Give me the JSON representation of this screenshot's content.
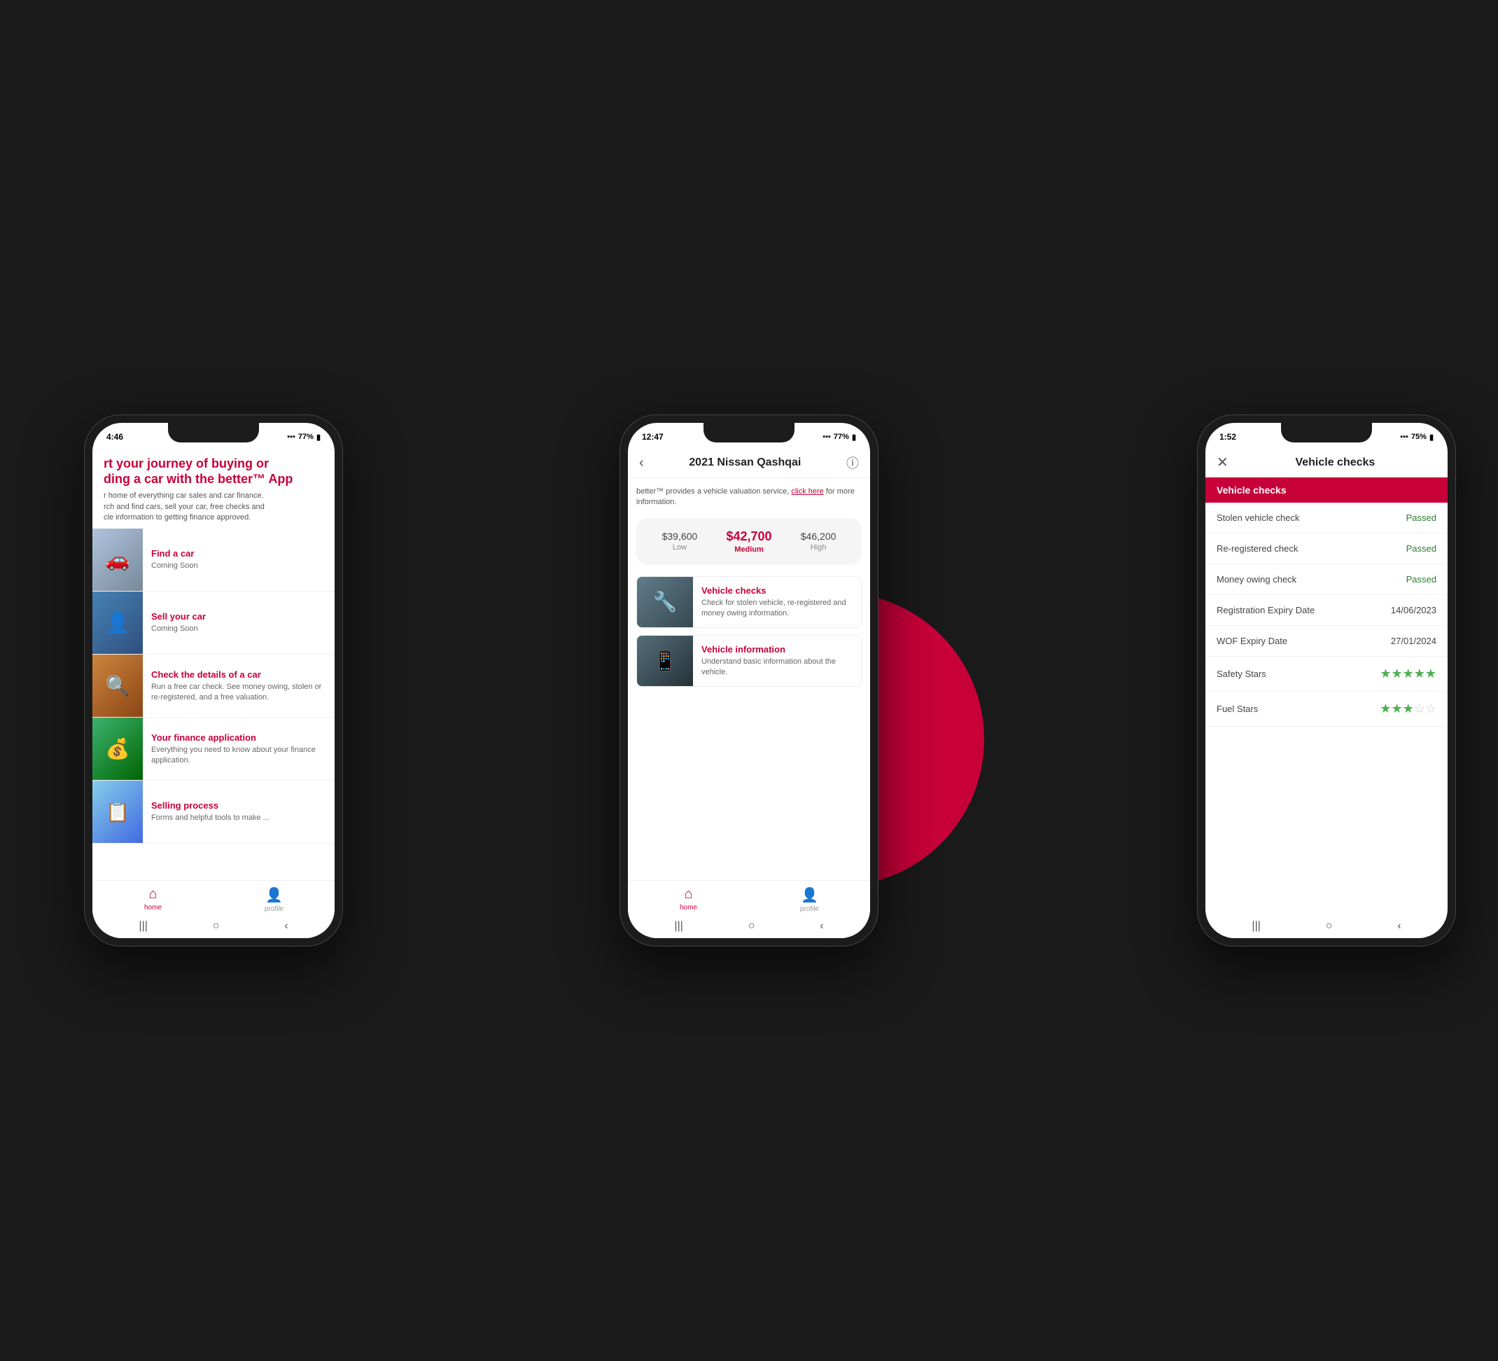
{
  "background": "#1a1a1a",
  "phone1": {
    "status": {
      "time": "4:46",
      "signal": "▪▪▪",
      "wifi": "wifi",
      "battery": "77%"
    },
    "header": {
      "title": "rt your journey of buying or\nding a car with the better™ App",
      "subtitle": "r home of everything car sales and car finance.\nrch and find cars, sell your car, free checks and\ncle information to getting finance approved."
    },
    "items": [
      {
        "title": "Find a car",
        "desc": "Coming Soon",
        "img": "🚗"
      },
      {
        "title": "Sell your car",
        "desc": "Coming Soon",
        "img": "👤"
      },
      {
        "title": "Check the details of a car",
        "desc": "Run a free car check. See money owing, stolen or re-registered, and a free valuation.",
        "img": "🔍"
      },
      {
        "title": "Your finance application",
        "desc": "Everything you need to know about your finance application.",
        "img": "💰"
      },
      {
        "title": "Selling process",
        "desc": "Forms and helpful tools to make ...",
        "img": "📋"
      }
    ],
    "nav": {
      "home": "home",
      "profile": "profile"
    },
    "homeBar": [
      "|||",
      "○",
      "‹"
    ]
  },
  "phone2": {
    "status": {
      "time": "12:47",
      "battery": "77%"
    },
    "header": {
      "back": "‹",
      "title": "2021 Nissan Qashqai",
      "info": "ⓘ"
    },
    "valuationNote": "better™ provides a vehicle valuation service, click here for more information.",
    "valuationLink": "click here",
    "valuation": {
      "low": {
        "amount": "$39,600",
        "label": "Low"
      },
      "medium": {
        "amount": "$42,700",
        "label": "Medium"
      },
      "high": {
        "amount": "$46,200",
        "label": "High"
      }
    },
    "features": [
      {
        "title": "Vehicle checks",
        "desc": "Check for stolen vehicle, re-registered and money owing information.",
        "img": "🔧"
      },
      {
        "title": "Vehicle information",
        "desc": "Understand basic information about the vehicle.",
        "img": "📱"
      }
    ],
    "nav": {
      "home": "home",
      "profile": "profile"
    },
    "homeBar": [
      "|||",
      "○",
      "‹"
    ]
  },
  "phone3": {
    "status": {
      "time": "1:52",
      "battery": "75%"
    },
    "header": {
      "close": "✕",
      "title": "Vehicle checks"
    },
    "tab": "Vehicle checks",
    "checks": [
      {
        "label": "Stolen vehicle check",
        "value": "Passed",
        "type": "passed"
      },
      {
        "label": "Re-registered check",
        "value": "Passed",
        "type": "passed"
      },
      {
        "label": "Money owing check",
        "value": "Passed",
        "type": "passed"
      },
      {
        "label": "Registration Expiry Date",
        "value": "14/06/2023",
        "type": "date"
      },
      {
        "label": "WOF Expiry Date",
        "value": "27/01/2024",
        "type": "date"
      },
      {
        "label": "Safety Stars",
        "value": "5",
        "type": "stars5"
      },
      {
        "label": "Fuel Stars",
        "value": "2.5",
        "type": "stars2half"
      }
    ],
    "homeBar": [
      "|||",
      "○",
      "‹"
    ]
  }
}
